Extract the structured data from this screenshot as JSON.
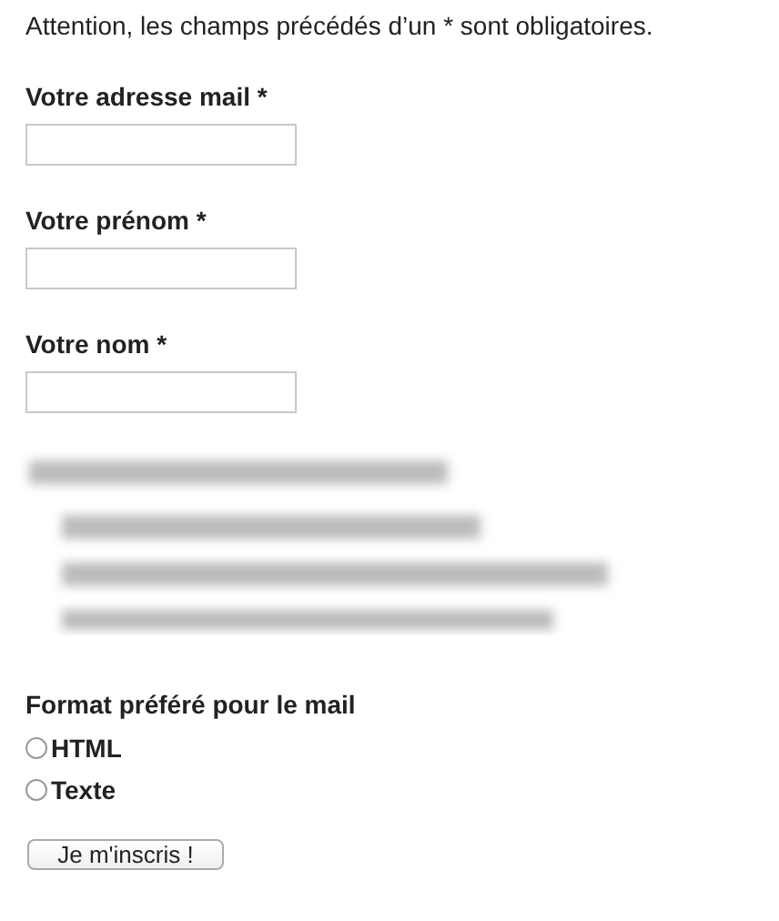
{
  "notice": "Attention, les champs précédés d’un * sont obligatoires.",
  "fields": [
    {
      "label": "Votre adresse mail *"
    },
    {
      "label": "Votre prénom *"
    },
    {
      "label": "Votre nom *"
    }
  ],
  "format": {
    "title": "Format préféré pour le mail",
    "options": [
      {
        "label": "HTML",
        "selected": false
      },
      {
        "label": "Texte",
        "selected": false
      }
    ]
  },
  "submit": "Je m'inscris !"
}
